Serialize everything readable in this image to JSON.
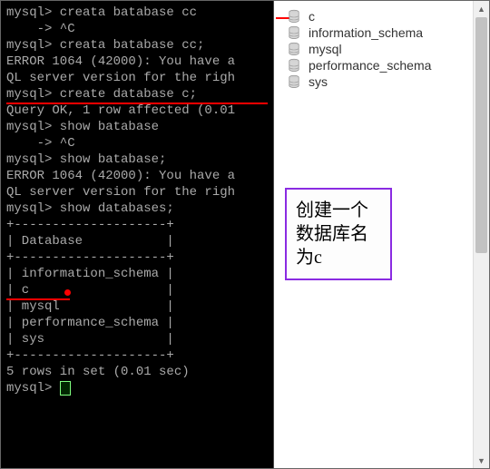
{
  "terminal": {
    "lines": [
      "mysql> creata batabase cc",
      "    -> ^C",
      "mysql> creata batabase cc;",
      "ERROR 1064 (42000): You have a",
      "QL server version for the righ",
      "mysql> create database c;",
      "Query OK, 1 row affected (0.01",
      "",
      "mysql> show batabase",
      "    -> ^C",
      "mysql> show batabase;",
      "ERROR 1064 (42000): You have a",
      "QL server version for the righ",
      "mysql> show databases;",
      "+--------------------+",
      "| Database           |",
      "+--------------------+",
      "| information_schema |",
      "| c                  |",
      "| mysql              |",
      "| performance_schema |",
      "| sys                |",
      "+--------------------+",
      "5 rows in set (0.01 sec)",
      "",
      "mysql> "
    ],
    "redline_full_index": 5,
    "redline_short_index": 18
  },
  "db_tree": {
    "items": [
      {
        "name": "c"
      },
      {
        "name": "information_schema"
      },
      {
        "name": "mysql"
      },
      {
        "name": "performance_schema"
      },
      {
        "name": "sys"
      }
    ],
    "highlight_index": 0
  },
  "annotation": {
    "line1": "创建一个",
    "line2": "数据库名",
    "line3": "为c"
  }
}
